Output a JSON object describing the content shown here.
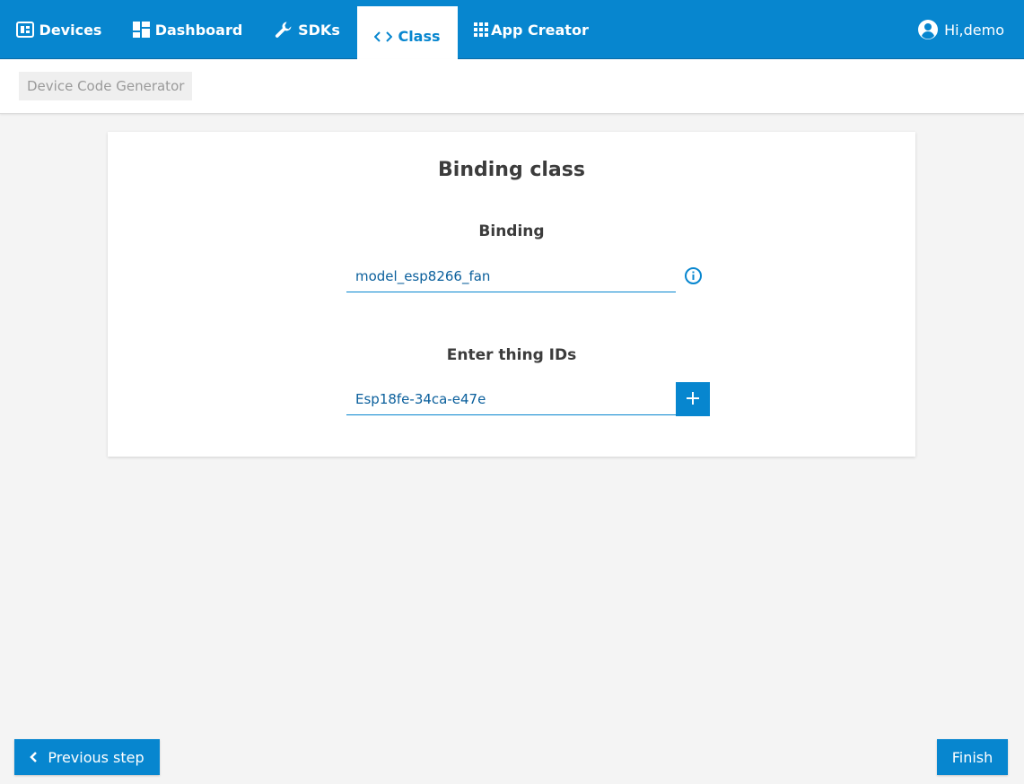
{
  "nav": {
    "items": [
      {
        "label": "Devices",
        "icon": "devices-icon"
      },
      {
        "label": "Dashboard",
        "icon": "dashboard-icon"
      },
      {
        "label": "SDKs",
        "icon": "wrench-icon"
      },
      {
        "label": "Class",
        "icon": "code-icon",
        "active": true
      },
      {
        "label": "App Creator",
        "icon": "grid-icon"
      }
    ],
    "user_label": "Hi,demo"
  },
  "breadcrumb": "Device Code Generator",
  "card": {
    "title": "Binding class",
    "binding_label": "Binding",
    "binding_value": "model_esp8266_fan",
    "thing_label": "Enter thing IDs",
    "thing_value": "Esp18fe-34ca-e47e"
  },
  "footer": {
    "prev_label": "Previous step",
    "finish_label": "Finish"
  },
  "colors": {
    "accent": "#0786cf",
    "background": "#f4f4f4"
  }
}
